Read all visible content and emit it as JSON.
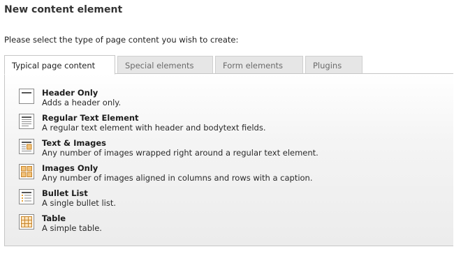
{
  "page": {
    "title": "New content element",
    "intro": "Please select the type of page content you wish to create:"
  },
  "tabs": [
    {
      "label": "Typical page content",
      "active": true
    },
    {
      "label": "Special elements",
      "active": false
    },
    {
      "label": "Form elements",
      "active": false
    },
    {
      "label": "Plugins",
      "active": false
    }
  ],
  "items": [
    {
      "name": "Header Only",
      "description": "Adds a header only.",
      "icon": "header-only-icon"
    },
    {
      "name": "Regular Text Element",
      "description": "A regular text element with header and bodytext fields.",
      "icon": "regular-text-icon"
    },
    {
      "name": "Text & Images",
      "description": "Any number of images wrapped right around a regular text element.",
      "icon": "text-images-icon"
    },
    {
      "name": "Images Only",
      "description": "Any number of images aligned in columns and rows with a caption.",
      "icon": "images-only-icon"
    },
    {
      "name": "Bullet List",
      "description": "A single bullet list.",
      "icon": "bullet-list-icon"
    },
    {
      "name": "Table",
      "description": "A simple table.",
      "icon": "table-icon"
    }
  ],
  "colors": {
    "icon_border": "#8a8a8a",
    "icon_accent": "#e8a33a",
    "tab_active_bg": "#ffffff",
    "tab_inactive_bg": "#e6e6e6"
  }
}
